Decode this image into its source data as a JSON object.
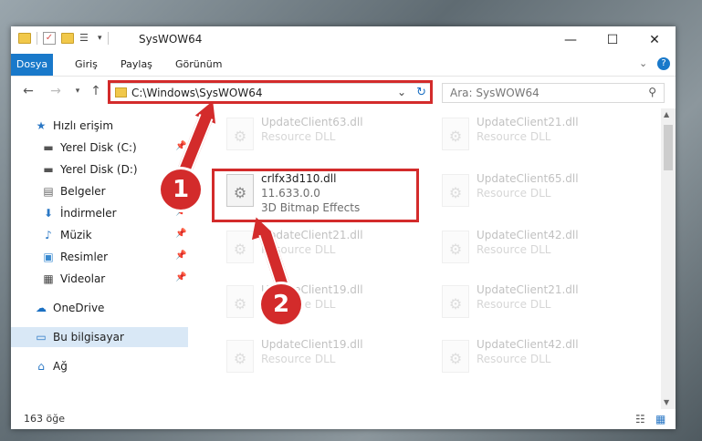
{
  "window": {
    "title": "SysWOW64"
  },
  "ribbon": {
    "tabs": [
      "Dosya",
      "Giriş",
      "Paylaş",
      "Görünüm"
    ]
  },
  "nav": {
    "address": "C:\\Windows\\SysWOW64",
    "search_placeholder": "Ara: SysWOW64"
  },
  "sidebar": {
    "items": [
      {
        "label": "Hızlı erişim"
      },
      {
        "label": "Yerel Disk (C:)"
      },
      {
        "label": "Yerel Disk (D:)"
      },
      {
        "label": "Belgeler"
      },
      {
        "label": "İndirmeler"
      },
      {
        "label": "Müzik"
      },
      {
        "label": "Resimler"
      },
      {
        "label": "Videolar"
      },
      {
        "label": "OneDrive"
      },
      {
        "label": "Bu bilgisayar"
      },
      {
        "label": "Ağ"
      }
    ]
  },
  "files": {
    "highlighted": {
      "name": "crlfx3d110.dll",
      "version": "11.633.0.0",
      "description": "3D Bitmap Effects"
    },
    "left_col": [
      {
        "name": "UpdateClient63.dll",
        "type": "Resource DLL"
      },
      {
        "name": "UpdateClient21.dll",
        "type": "Resource DLL"
      },
      {
        "name": "UpdateClient19.dll",
        "type": "Resource DLL"
      },
      {
        "name": "UpdateClient19.dll",
        "type": "Resource DLL"
      }
    ],
    "right_col": [
      {
        "name": "UpdateClient21.dll",
        "type": "Resource DLL"
      },
      {
        "name": "UpdateClient65.dll",
        "type": "Resource DLL"
      },
      {
        "name": "UpdateClient42.dll",
        "type": "Resource DLL"
      },
      {
        "name": "UpdateClient21.dll",
        "type": "Resource DLL"
      },
      {
        "name": "UpdateClient42.dll",
        "type": "Resource DLL"
      }
    ]
  },
  "status": {
    "count": "163 öğe"
  },
  "annotations": {
    "badge1": "1",
    "badge2": "2"
  },
  "colors": {
    "accent": "#1979ca",
    "highlight": "#d32b2b"
  }
}
